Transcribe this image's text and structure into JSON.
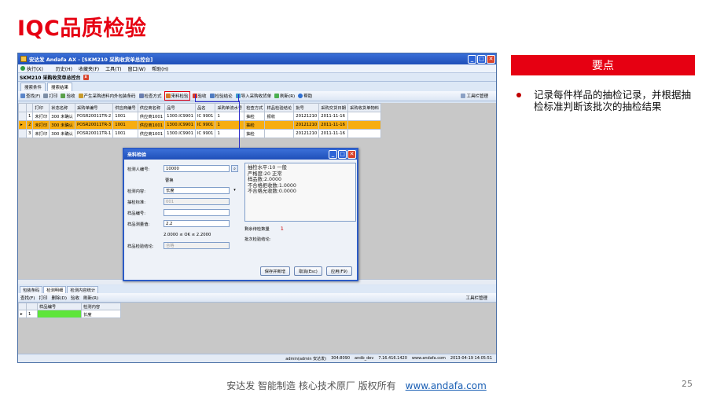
{
  "slide": {
    "title": "IQC品质检验",
    "keypoint_label": "要点",
    "bullet": "记录每件样品的抽检记录，并根据抽检标准判断该批次的抽检结果",
    "footer_text": "安达发   智能制造 核心技术原厂   版权所有",
    "footer_link": "www.andafa.com",
    "page_number": "25"
  },
  "app": {
    "window_title": "安达发 Andafa AX - [SKM210 采购收货单总控台]",
    "menu": [
      "执行(X)",
      "历史(H)",
      "收藏夹(F)",
      "工具(T)",
      "窗口(W)",
      "帮助(H)"
    ],
    "doc_title": "SKM210 采购收货单总控台",
    "tabs": [
      "搜索条件",
      "搜索结果"
    ],
    "toolbar": [
      "查找(F)",
      "打印",
      "验收",
      "产生采购进料内外包装条码",
      "检查方式",
      "来料检验",
      "验收",
      "检验结论",
      "导入采购收货单",
      "刷新(R)",
      "帮助"
    ],
    "toolbar_right": "工具栏管理",
    "grid_headers": [
      "打印",
      "状态名称",
      "采购单编号",
      "供应商编号",
      "供应商名称",
      "品号",
      "品名",
      "采购单流水号",
      "检查方式",
      "样品检验结论",
      "批号",
      "采购交货日期",
      "采购收货单物料"
    ],
    "grid_rows": [
      [
        "1",
        "未打印",
        "300 未确认",
        "POSR20011TR-2",
        "1001",
        "供应商1001",
        "1300.IC9901",
        "IC 9901",
        "1",
        "抽检",
        "报收",
        "20121210",
        "2011-11-16",
        ""
      ],
      [
        "2",
        "未打印",
        "300 未确认",
        "POSR20011TR-3",
        "1001",
        "供应商1001",
        "1300.IC9901",
        "IC 9901",
        "1",
        "抽检",
        "",
        "20121210",
        "2011-11-16",
        ""
      ],
      [
        "3",
        "未打印",
        "300 未确认",
        "POSR20011TR-1",
        "1001",
        "供应商1001",
        "1300.IC9901",
        "IC 9901",
        "1",
        "抽检",
        "",
        "20121210",
        "2011-11-16",
        ""
      ]
    ],
    "lower_tabs": [
      "包装条码",
      "检测明细",
      "检测内容统计"
    ],
    "lower_toolbar": [
      "查找(F)",
      "打印",
      "删除(D)",
      "验收",
      "刷新(R)"
    ],
    "lower_headers": [
      "样品编号",
      "检测内容"
    ],
    "lower_row": {
      "index": "1",
      "content": "长度"
    },
    "status": [
      "admin(admin 安达发)",
      "304:8090",
      "andb_dev",
      "7.16.416.1420",
      "www.andafa.com",
      "2013-04-19 14:05:51"
    ]
  },
  "dialog": {
    "title": "来料检验",
    "fields": [
      {
        "label": "检测人编号:",
        "value": "10000"
      },
      {
        "label": "",
        "value": "曹换"
      },
      {
        "label": "检测内容:",
        "value": "长度"
      },
      {
        "label": "抽检标准:",
        "value": "001"
      },
      {
        "label": "样品编号:",
        "value": ""
      },
      {
        "label": "样品测量值:",
        "value": "2.2"
      }
    ],
    "range_text": "2.0000  ≤  OK  ≤  2.2000",
    "conclusion_label": "样品检验结论:",
    "conclusion_value": "合格",
    "info_lines": [
      "抽检水平:10 一般",
      "严格度:20 正常",
      "样品数:2.0000",
      "不合格拒收数:1.0000",
      "不合格允收数:0.0000"
    ],
    "remain_label": "剩余待检数量",
    "remain_value": "1",
    "batch_label": "批次检验结论:",
    "buttons": [
      "保存并新增",
      "取消(Esc)",
      "应用(F9)"
    ]
  }
}
